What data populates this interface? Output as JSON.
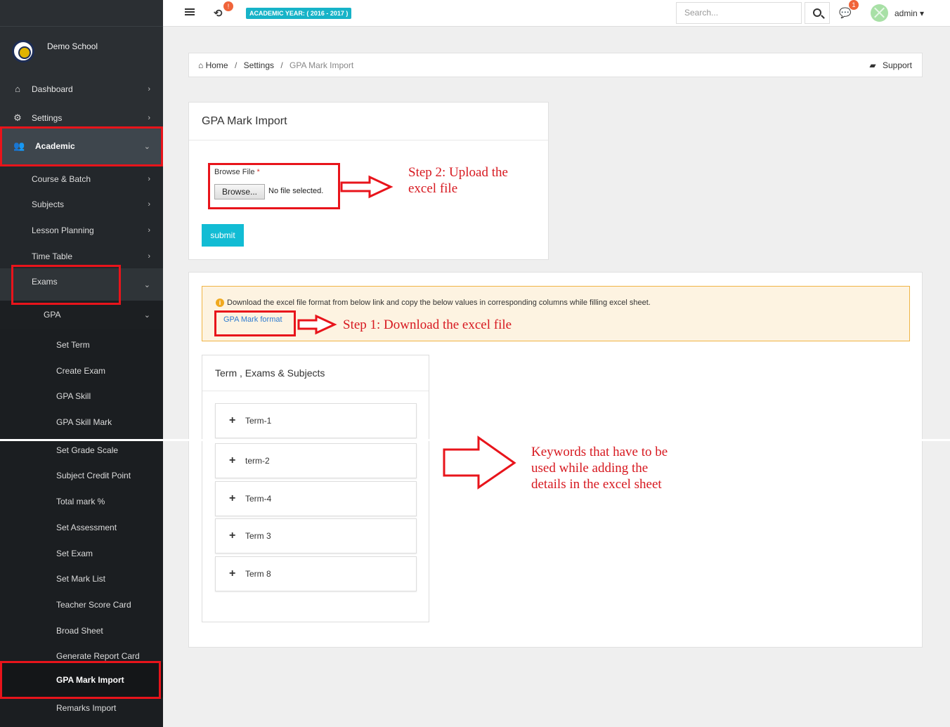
{
  "topbar": {
    "sync_badge": "!",
    "academic_year": "ACADEMIC YEAR: ( 2016 - 2017 )",
    "search_placeholder": "Search...",
    "chat_badge": "1",
    "user_name": "admin",
    "user_caret": "▾"
  },
  "sidebar": {
    "school_name": "Demo School",
    "items": [
      {
        "label": "Dashboard",
        "icon": "home-icon"
      },
      {
        "label": "Settings",
        "icon": "gears-icon"
      },
      {
        "label": "Academic",
        "icon": "users-icon"
      }
    ],
    "academic_sub": [
      {
        "label": "Course & Batch"
      },
      {
        "label": "Subjects"
      },
      {
        "label": "Lesson Planning"
      },
      {
        "label": "Time Table"
      },
      {
        "label": "Exams"
      }
    ],
    "exams_sub": {
      "label": "GPA"
    },
    "gpa_items": [
      "Set Term",
      "Create Exam",
      "GPA Skill",
      "GPA Skill Mark",
      "Set Grade Scale",
      "Subject Credit Point",
      "Total mark %",
      "Set Assessment",
      "Set Exam",
      "Set Mark List",
      "Teacher Score Card",
      "Broad Sheet",
      "Generate Report Card",
      "GPA Mark Import",
      "Remarks Import"
    ]
  },
  "breadcrumb": {
    "home": "Home",
    "settings": "Settings",
    "current": "GPA Mark Import",
    "separator": "/",
    "support": "Support"
  },
  "import_card": {
    "title": "GPA Mark Import",
    "file_label": "Browse File",
    "required_mark": "*",
    "browse_button": "Browse...",
    "no_file": "No file selected.",
    "submit": "submit"
  },
  "alert": {
    "message": "Download the excel file format from below link and copy the below values in corresponding columns while filling excel sheet.",
    "link": "GPA Mark format"
  },
  "terms_card": {
    "title": "Term , Exams & Subjects",
    "terms": [
      "Term-1",
      "term-2",
      "Term-4",
      "Term 3",
      "Term 8"
    ]
  },
  "annotations": {
    "step2_line1": "Step 2: Upload the",
    "step2_line2": "excel file",
    "step1": "Step 1: Download the excel file",
    "keywords_line1": "Keywords that have to be",
    "keywords_line2": "used while adding the",
    "keywords_line3": "details in the excel sheet"
  },
  "colors": {
    "accent": "#12bcd4",
    "annotation_red": "#e8141b",
    "sidebar": "#2b2f33",
    "alert_bg": "#fdf3e1",
    "alert_border": "#f0b445"
  }
}
